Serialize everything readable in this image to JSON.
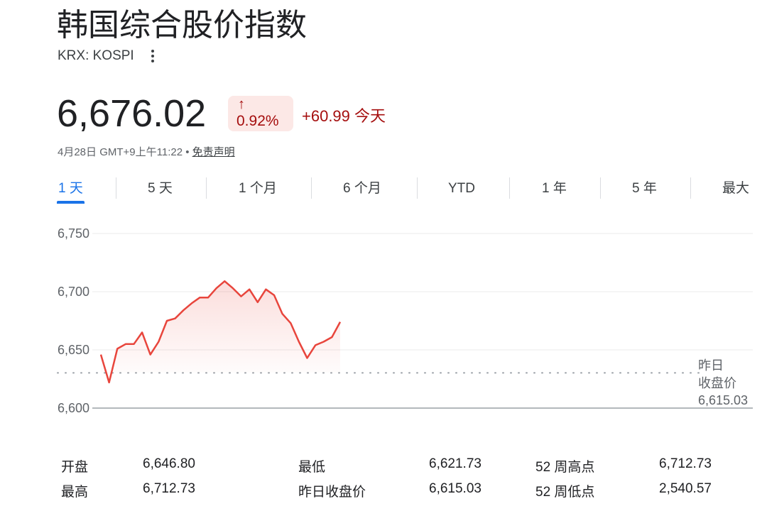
{
  "header": {
    "title": "韩国综合股价指数",
    "ticker": "KRX: KOSPI"
  },
  "quote": {
    "price": "6,676.02",
    "change_arrow": "↑",
    "change_percent": "0.92%",
    "change_value": "+60.99 今天",
    "timestamp": "4月28日 GMT+9上午11:22 • ",
    "disclaimer": "免责声明"
  },
  "tabs": [
    {
      "label": "1 天",
      "active": true
    },
    {
      "label": "5 天"
    },
    {
      "label": "1 个月"
    },
    {
      "label": "6 个月"
    },
    {
      "label": "YTD"
    },
    {
      "label": "1 年"
    },
    {
      "label": "5 年"
    },
    {
      "label": "最大"
    }
  ],
  "colors": {
    "accent": "#1a73e8",
    "line": "#e8453c",
    "negative_text": "#a50e0e",
    "badge_bg": "#fce8e6"
  },
  "chart_data": {
    "type": "area",
    "y_ticks": [
      "6,750",
      "6,700",
      "6,650",
      "6,600"
    ],
    "ylim": [
      6600,
      6750
    ],
    "n_slots": 80,
    "values": [
      6646,
      6622,
      6651,
      6655,
      6655,
      6665,
      6646,
      6657,
      6675,
      6677,
      6684,
      6690,
      6695,
      6695,
      6703,
      6709,
      6703,
      6696,
      6702,
      6691,
      6702,
      6697,
      6681,
      6673,
      6657,
      6643,
      6654,
      6657,
      6661,
      6674
    ],
    "previous_close": 6615.03,
    "previous_close_label_line1": "昨日",
    "previous_close_label_line2": "收盘价",
    "previous_close_value": "6,615.03",
    "grid": true
  },
  "stats": [
    {
      "label": "开盘",
      "value": "6,646.80"
    },
    {
      "label": "最高",
      "value": "6,712.73"
    },
    {
      "label": "最低",
      "value": "6,621.73"
    },
    {
      "label": "昨日收盘价",
      "value": "6,615.03"
    },
    {
      "label": "52 周高点",
      "value": "6,712.73"
    },
    {
      "label": "52 周低点",
      "value": "2,540.57"
    }
  ]
}
